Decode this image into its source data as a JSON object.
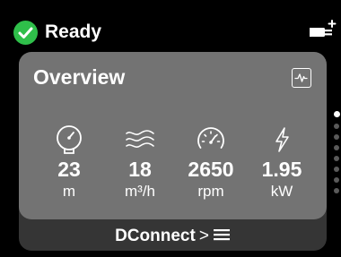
{
  "status": {
    "text": "Ready",
    "icon": "checkmark-circle-icon",
    "color": "#2fbf4a"
  },
  "connection_icon": "plug-plus-icon",
  "card": {
    "title": "Overview",
    "chart_button_icon": "pulse-chart-icon",
    "background": "#737373",
    "metrics": [
      {
        "icon": "pressure-gauge-icon",
        "value": "23",
        "unit": "m"
      },
      {
        "icon": "flow-waves-icon",
        "value": "18",
        "unit": "m³/h"
      },
      {
        "icon": "speedometer-icon",
        "value": "2650",
        "unit": "rpm"
      },
      {
        "icon": "lightning-icon",
        "value": "1.95",
        "unit": "kW"
      }
    ]
  },
  "footer": {
    "label": "DConnect",
    "chevron": ">",
    "menu_icon": "hamburger-menu-icon",
    "background": "#353535"
  },
  "pager": {
    "count": 8,
    "active_index": 0
  }
}
